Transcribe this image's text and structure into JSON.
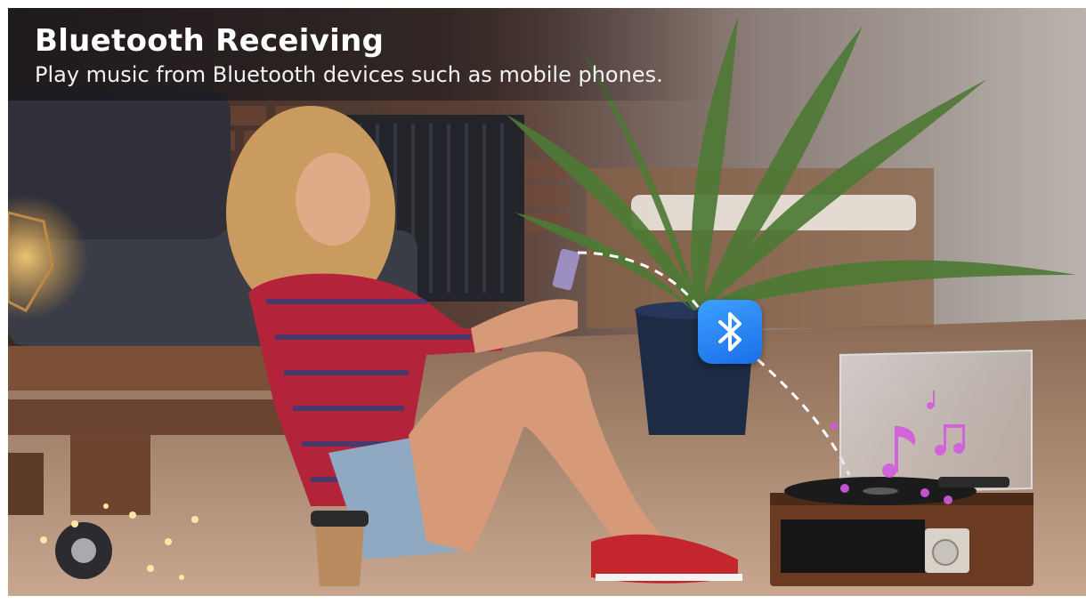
{
  "banner": {
    "title": "Bluetooth Receiving",
    "subtitle": "Play music from Bluetooth devices such as mobile phones."
  },
  "icons": [
    "bluetooth-icon",
    "music-note-icon"
  ],
  "colors": {
    "bluetooth_blue": "#1f7cf0",
    "music_note_magenta": "#d35be0",
    "shirt_red": "#b3243a",
    "shoe_red": "#c4262e",
    "wood_brown": "#6a3b22"
  }
}
